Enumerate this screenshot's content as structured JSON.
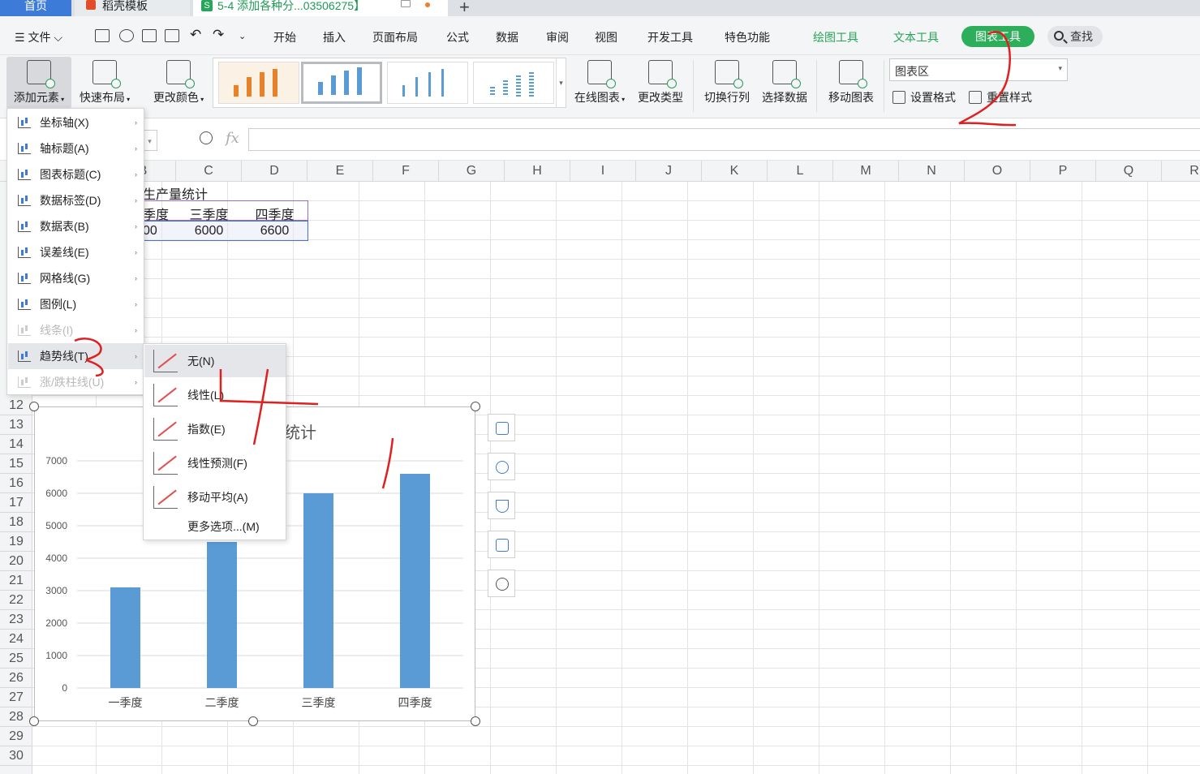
{
  "tabs": {
    "home": "首页",
    "template": "稻壳模板",
    "document": "5-4 添加各种分...03506275】"
  },
  "menu": {
    "file": "文件",
    "items": [
      "开始",
      "插入",
      "页面布局",
      "公式",
      "数据",
      "审阅",
      "视图",
      "开发工具",
      "特色功能"
    ],
    "tools": [
      "绘图工具",
      "文本工具"
    ],
    "chart_tools": "图表工具",
    "find": "查找"
  },
  "ribbon": {
    "add_element": "添加元素",
    "quick_layout": "快速布局",
    "change_color": "更改颜色",
    "online_chart": "在线图表",
    "change_type": "更改类型",
    "switch_row_col": "切换行列",
    "select_data": "选择数据",
    "move_chart": "移动图表",
    "chart_area": "图表区",
    "set_format": "设置格式",
    "reset_style": "重置样式"
  },
  "columns": [
    "B",
    "C",
    "D",
    "E",
    "F",
    "G",
    "H",
    "I",
    "J",
    "K",
    "L",
    "M",
    "N",
    "O",
    "P",
    "Q",
    "R"
  ],
  "rows": [
    "12",
    "13",
    "14",
    "15",
    "16",
    "17",
    "18",
    "19",
    "20",
    "21",
    "22",
    "23",
    "24",
    "25",
    "26",
    "27",
    "28",
    "29",
    "30"
  ],
  "cells": {
    "title": "生产量统计",
    "headers": [
      "季度",
      "三季度",
      "四季度"
    ],
    "values": [
      "00",
      "6000",
      "6600"
    ]
  },
  "dropdown": {
    "items": [
      {
        "label": "坐标轴(X)",
        "disabled": false
      },
      {
        "label": "轴标题(A)",
        "disabled": false
      },
      {
        "label": "图表标题(C)",
        "disabled": false
      },
      {
        "label": "数据标签(D)",
        "disabled": false
      },
      {
        "label": "数据表(B)",
        "disabled": false
      },
      {
        "label": "误差线(E)",
        "disabled": false
      },
      {
        "label": "网格线(G)",
        "disabled": false
      },
      {
        "label": "图例(L)",
        "disabled": false
      },
      {
        "label": "线条(I)",
        "disabled": true
      },
      {
        "label": "趋势线(T)",
        "disabled": false
      },
      {
        "label": "涨/跌柱线(U)",
        "disabled": true
      }
    ]
  },
  "submenu": {
    "items": [
      "无(N)",
      "线性(L)",
      "指数(E)",
      "线性预测(F)",
      "移动平均(A)",
      "更多选项...(M)"
    ]
  },
  "chart": {
    "title_visible": "统计",
    "colors": {
      "bar": "#5b9bd5"
    }
  },
  "chart_data": {
    "type": "bar",
    "categories": [
      "一季度",
      "二季度",
      "三季度",
      "四季度"
    ],
    "series": [
      {
        "values": [
          3100,
          4500,
          6000,
          6600
        ]
      }
    ],
    "yticks": [
      "0",
      "1000",
      "2000",
      "3000",
      "4000",
      "5000",
      "6000",
      "7000"
    ],
    "ylim": [
      0,
      7000
    ],
    "grid": true
  }
}
